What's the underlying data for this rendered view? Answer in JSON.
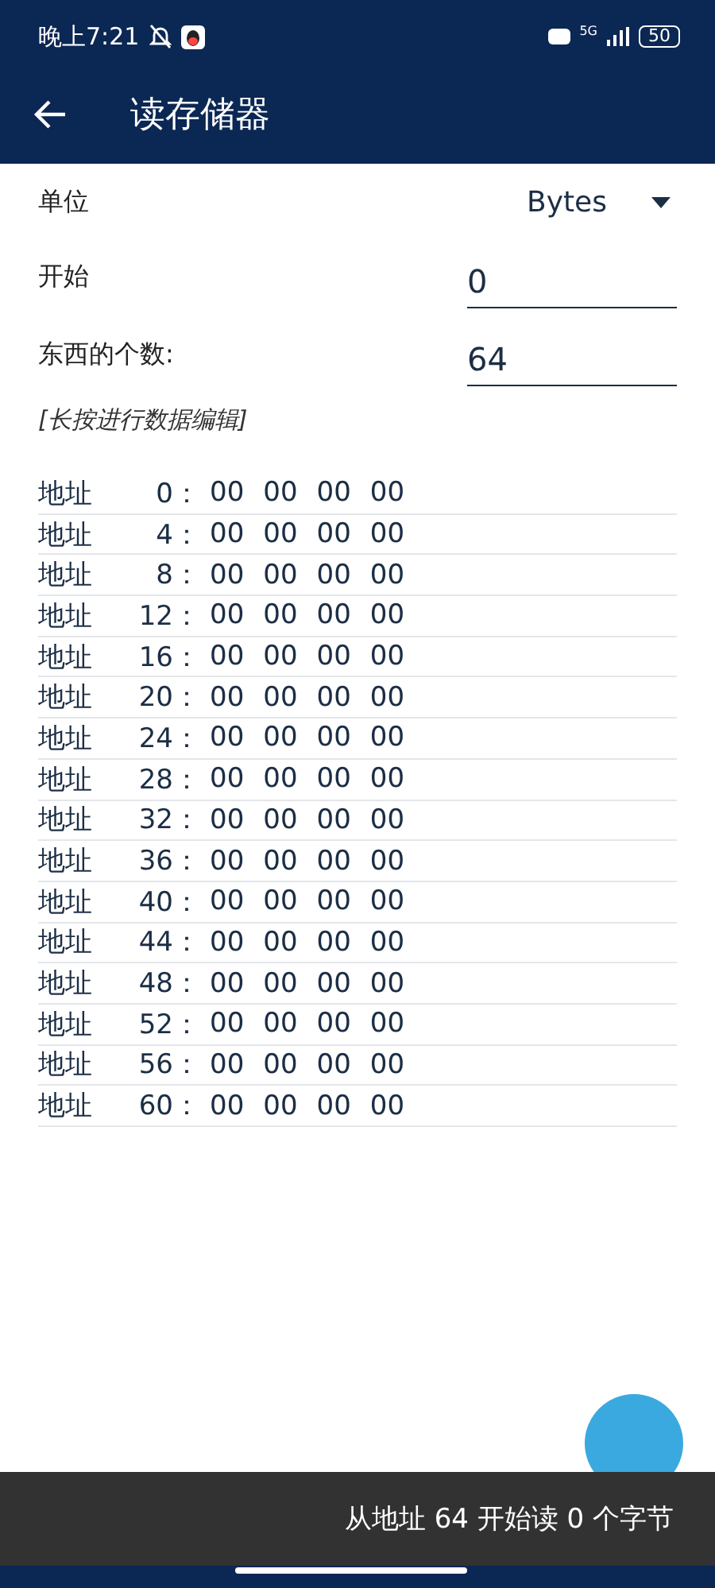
{
  "status_bar": {
    "time": "晚上7:21",
    "network": "5G",
    "battery": "50"
  },
  "app_bar": {
    "title": "读存储器"
  },
  "form": {
    "unit_label": "单位",
    "unit_value": "Bytes",
    "start_label": "开始",
    "start_value": "0",
    "count_label": "东西的个数:",
    "count_value": "64",
    "hint": "[长按进行数据编辑]"
  },
  "rows": [
    {
      "label": "地址",
      "address": "0：",
      "bytes": [
        "00",
        "00",
        "00",
        "00"
      ]
    },
    {
      "label": "地址",
      "address": "4：",
      "bytes": [
        "00",
        "00",
        "00",
        "00"
      ]
    },
    {
      "label": "地址",
      "address": "8：",
      "bytes": [
        "00",
        "00",
        "00",
        "00"
      ]
    },
    {
      "label": "地址",
      "address": "12：",
      "bytes": [
        "00",
        "00",
        "00",
        "00"
      ]
    },
    {
      "label": "地址",
      "address": "16：",
      "bytes": [
        "00",
        "00",
        "00",
        "00"
      ]
    },
    {
      "label": "地址",
      "address": "20：",
      "bytes": [
        "00",
        "00",
        "00",
        "00"
      ]
    },
    {
      "label": "地址",
      "address": "24：",
      "bytes": [
        "00",
        "00",
        "00",
        "00"
      ]
    },
    {
      "label": "地址",
      "address": "28：",
      "bytes": [
        "00",
        "00",
        "00",
        "00"
      ]
    },
    {
      "label": "地址",
      "address": "32：",
      "bytes": [
        "00",
        "00",
        "00",
        "00"
      ]
    },
    {
      "label": "地址",
      "address": "36：",
      "bytes": [
        "00",
        "00",
        "00",
        "00"
      ]
    },
    {
      "label": "地址",
      "address": "40：",
      "bytes": [
        "00",
        "00",
        "00",
        "00"
      ]
    },
    {
      "label": "地址",
      "address": "44：",
      "bytes": [
        "00",
        "00",
        "00",
        "00"
      ]
    },
    {
      "label": "地址",
      "address": "48：",
      "bytes": [
        "00",
        "00",
        "00",
        "00"
      ]
    },
    {
      "label": "地址",
      "address": "52：",
      "bytes": [
        "00",
        "00",
        "00",
        "00"
      ]
    },
    {
      "label": "地址",
      "address": "56：",
      "bytes": [
        "00",
        "00",
        "00",
        "00"
      ]
    },
    {
      "label": "地址",
      "address": "60：",
      "bytes": [
        "00",
        "00",
        "00",
        "00"
      ]
    }
  ],
  "snackbar": {
    "message": "从地址 64 开始读 0 个字节"
  }
}
